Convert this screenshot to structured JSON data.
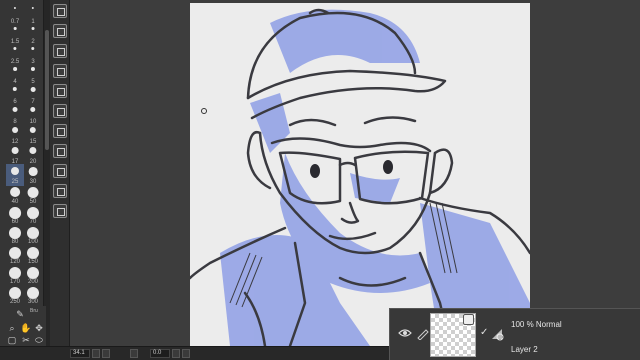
{
  "brush_sizes": {
    "rows": [
      [
        "0.7",
        "1"
      ],
      [
        "1.5",
        "2"
      ],
      [
        "2.5",
        "3"
      ],
      [
        "4",
        "5"
      ],
      [
        "6",
        "7"
      ],
      [
        "8",
        "10"
      ],
      [
        "12",
        "15"
      ],
      [
        "17",
        "20"
      ],
      [
        "25",
        "30"
      ],
      [
        "40",
        "50"
      ],
      [
        "60",
        "70"
      ],
      [
        "80",
        "100"
      ],
      [
        "120",
        "150"
      ],
      [
        "170",
        "200"
      ],
      [
        "250",
        "300"
      ]
    ],
    "selected": "25"
  },
  "icons": {
    "strip": [
      "close-square-icon",
      "close-square-icon",
      "panel-icon",
      "panel-icon",
      "panel-icon",
      "panel-icon",
      "panel-icon",
      "panel-icon",
      "panel-icon",
      "panel-icon",
      "panel-icon"
    ],
    "tools": [
      "pen-tool-icon",
      "zoom-icon",
      "hand-icon",
      "move-icon",
      "select-icon",
      "eyedropper-icon"
    ]
  },
  "tool_palette": {
    "active_tool_label": "Bru"
  },
  "status_bar": {
    "zoom": "34.1",
    "angle": "0.0"
  },
  "layer": {
    "blend_mode": "100 % Normal",
    "name": "Layer 2"
  },
  "colors": {
    "accent": "#8f9fe6",
    "line_art": "#3a3a40",
    "panel_bg": "#383838"
  }
}
